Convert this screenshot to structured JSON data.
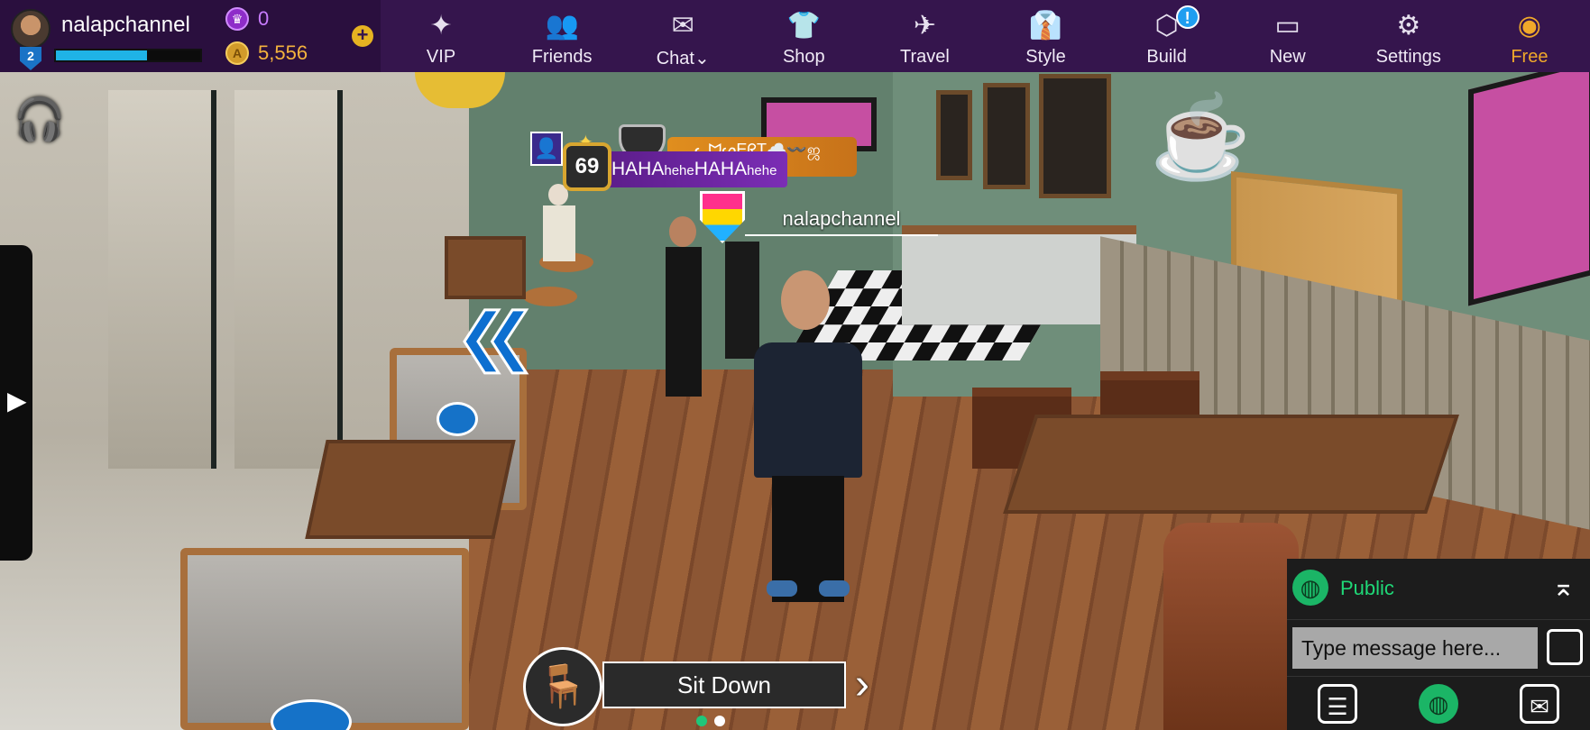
{
  "profile": {
    "username": "nalapchannel",
    "level": "2",
    "xp_fraction": 0.63
  },
  "currency": {
    "gems": "0",
    "coins": "5,556"
  },
  "nav": [
    {
      "label": "VIP",
      "icon": "vip-star-icon"
    },
    {
      "label": "Friends",
      "icon": "friends-icon"
    },
    {
      "label": "Chat",
      "icon": "mail-icon"
    },
    {
      "label": "Shop",
      "icon": "shirt-tag-icon"
    },
    {
      "label": "Travel",
      "icon": "airplane-icon"
    },
    {
      "label": "Style",
      "icon": "outfit-icon"
    },
    {
      "label": "Build",
      "icon": "cube-icon",
      "badge": "!"
    },
    {
      "label": "New",
      "icon": "new-layout-icon"
    },
    {
      "label": "Settings",
      "icon": "gear-icon"
    },
    {
      "label": "Free",
      "icon": "coins-stack-icon"
    }
  ],
  "scene": {
    "player_level": "69",
    "player_status": "HAHAheheHAHAhehe",
    "other_tag": "ᓚᗢᔕEᖇT☁️〰️ஜ",
    "self_name": "nalapchannel"
  },
  "sit": {
    "label": "Sit Down"
  },
  "chat": {
    "channel": "Public",
    "placeholder": "Type message here..."
  },
  "colors": {
    "topbar": "#35154d",
    "xp": "#1fb3e6",
    "coins": "#f4b33d",
    "gems": "#c87cff",
    "public": "#1fd877",
    "free": "#f0a82a"
  }
}
